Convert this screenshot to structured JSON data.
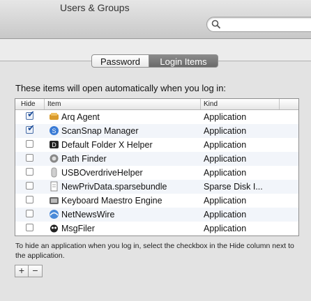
{
  "window": {
    "title": "Users & Groups"
  },
  "search": {
    "value": "",
    "placeholder": ""
  },
  "tabs": [
    {
      "label": "Password",
      "selected": false
    },
    {
      "label": "Login Items",
      "selected": true
    }
  ],
  "intro": "These items will open automatically when you log in:",
  "table": {
    "columns": {
      "hide": "Hide",
      "item": "Item",
      "kind": "Kind"
    },
    "rows": [
      {
        "hide": true,
        "icon": "arq-agent-icon",
        "name": "Arq Agent",
        "kind": "Application"
      },
      {
        "hide": true,
        "icon": "scansnap-icon",
        "name": "ScanSnap Manager",
        "kind": "Application"
      },
      {
        "hide": false,
        "icon": "default-folder-icon",
        "name": "Default Folder X Helper",
        "kind": "Application"
      },
      {
        "hide": false,
        "icon": "path-finder-icon",
        "name": "Path Finder",
        "kind": "Application"
      },
      {
        "hide": false,
        "icon": "usb-overdrive-icon",
        "name": "USBOverdriveHelper",
        "kind": "Application"
      },
      {
        "hide": false,
        "icon": "sparse-bundle-icon",
        "name": "NewPrivData.sparsebundle",
        "kind": "Sparse Disk I..."
      },
      {
        "hide": false,
        "icon": "keyboard-maestro-icon",
        "name": "Keyboard Maestro Engine",
        "kind": "Application"
      },
      {
        "hide": false,
        "icon": "netnewswire-icon",
        "name": "NetNewsWire",
        "kind": "Application"
      },
      {
        "hide": false,
        "icon": "msgfiler-icon",
        "name": "MsgFiler",
        "kind": "Application"
      }
    ]
  },
  "hint": "To hide an application when you log in, select the checkbox in the Hide column next to the application.",
  "buttons": {
    "add": "+",
    "remove": "−"
  },
  "colors": {
    "selected_tab": "#7a7a7a",
    "checkbox_check": "#1e4e9a",
    "stripe": "#f2f5fa"
  }
}
